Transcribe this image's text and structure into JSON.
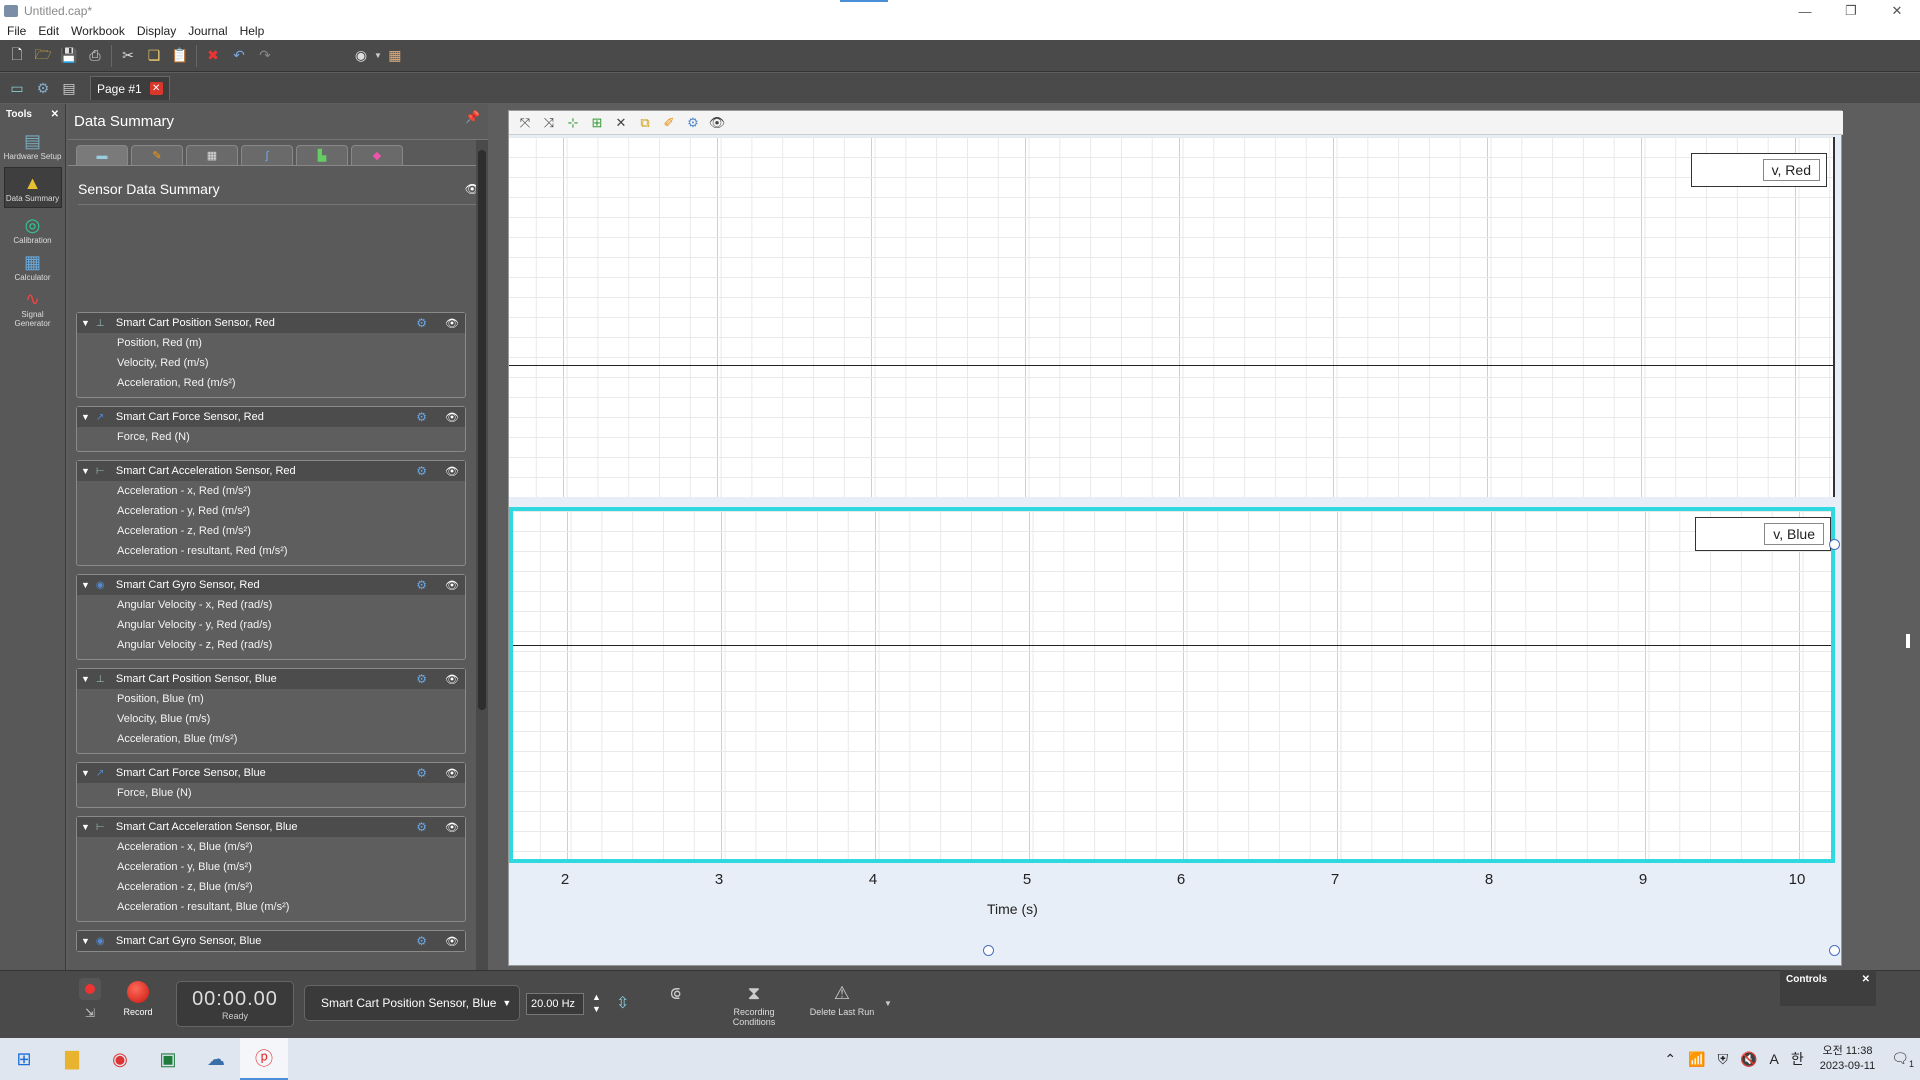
{
  "window": {
    "title": "Untitled.cap*"
  },
  "menu": [
    "File",
    "Edit",
    "Workbook",
    "Display",
    "Journal",
    "Help"
  ],
  "page_tab": {
    "label": "Page #1"
  },
  "tools": {
    "header": "Tools",
    "items": [
      "Hardware Setup",
      "Data Summary",
      "Calibration",
      "Calculator",
      "Signal Generator"
    ]
  },
  "summary": {
    "title": "Data Summary",
    "section_title": "Sensor Data Summary",
    "groups": [
      {
        "name": "Smart Cart Position Sensor, Red",
        "measurements": [
          "Position, Red (m)",
          "Velocity, Red (m/s)",
          "Acceleration, Red (m/s²)"
        ]
      },
      {
        "name": "Smart Cart Force Sensor, Red",
        "measurements": [
          "Force, Red (N)"
        ]
      },
      {
        "name": "Smart Cart Acceleration Sensor, Red",
        "measurements": [
          "Acceleration - x, Red (m/s²)",
          "Acceleration - y, Red (m/s²)",
          "Acceleration - z, Red (m/s²)",
          "Acceleration - resultant, Red (m/s²)"
        ]
      },
      {
        "name": "Smart Cart Gyro Sensor, Red",
        "measurements": [
          "Angular Velocity - x, Red (rad/s)",
          "Angular Velocity - y, Red (rad/s)",
          "Angular Velocity - z, Red (rad/s)"
        ]
      },
      {
        "name": "Smart Cart Position Sensor, Blue",
        "measurements": [
          "Position, Blue (m)",
          "Velocity, Blue (m/s)",
          "Acceleration, Blue (m/s²)"
        ]
      },
      {
        "name": "Smart Cart Force Sensor, Blue",
        "measurements": [
          "Force, Blue (N)"
        ]
      },
      {
        "name": "Smart Cart Acceleration Sensor, Blue",
        "measurements": [
          "Acceleration - x, Blue (m/s²)",
          "Acceleration - y, Blue (m/s²)",
          "Acceleration - z, Blue (m/s²)",
          "Acceleration - resultant, Blue (m/s²)"
        ]
      },
      {
        "name": "Smart Cart Gyro Sensor, Blue",
        "measurements": []
      }
    ]
  },
  "graph": {
    "legend_top": "v, Red",
    "legend_bottom": "v, Blue",
    "x_ticks": [
      "2",
      "3",
      "4",
      "5",
      "6",
      "7",
      "8",
      "9",
      "10"
    ],
    "x_label": "Time (s)"
  },
  "controls": {
    "record_label": "Record",
    "timer": "00:00.00",
    "status": "Ready",
    "sensor": "Smart Cart Position Sensor, Blue",
    "rate": "20.00 Hz",
    "recording_conditions": "Recording Conditions",
    "delete_last_run": "Delete Last Run",
    "panel_title": "Controls"
  },
  "taskbar": {
    "time": "오전 11:38",
    "date": "2023-09-11",
    "ime": "한",
    "notifications": "1"
  },
  "colors": {
    "accent_cyan": "#30d8e0",
    "record_red": "#d9362c"
  }
}
